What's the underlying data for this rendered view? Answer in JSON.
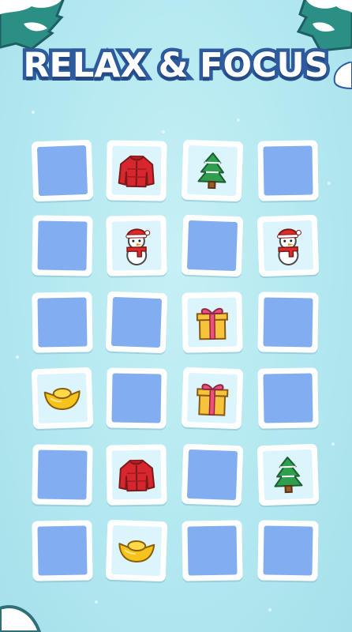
{
  "title": "RELAX & FOCUS",
  "colors": {
    "background": "#b3e8f0",
    "card_back": "#82aef1",
    "card_face": "#dcf4fb",
    "title_stroke": "#2e5a9e"
  },
  "board": {
    "rows": 6,
    "cols": 4,
    "cards": [
      {
        "state": "down"
      },
      {
        "state": "up",
        "icon": "jacket-icon"
      },
      {
        "state": "up",
        "icon": "pine-tree-icon"
      },
      {
        "state": "down"
      },
      {
        "state": "down"
      },
      {
        "state": "up",
        "icon": "snowman-icon"
      },
      {
        "state": "down"
      },
      {
        "state": "up",
        "icon": "snowman-icon"
      },
      {
        "state": "down"
      },
      {
        "state": "down"
      },
      {
        "state": "up",
        "icon": "gift-box-icon"
      },
      {
        "state": "down"
      },
      {
        "state": "up",
        "icon": "gold-ingot-icon"
      },
      {
        "state": "down"
      },
      {
        "state": "up",
        "icon": "gift-box-icon"
      },
      {
        "state": "down"
      },
      {
        "state": "down"
      },
      {
        "state": "up",
        "icon": "jacket-icon"
      },
      {
        "state": "down"
      },
      {
        "state": "up",
        "icon": "pine-tree-icon"
      },
      {
        "state": "down"
      },
      {
        "state": "up",
        "icon": "gold-ingot-icon"
      },
      {
        "state": "down"
      },
      {
        "state": "down"
      }
    ]
  }
}
